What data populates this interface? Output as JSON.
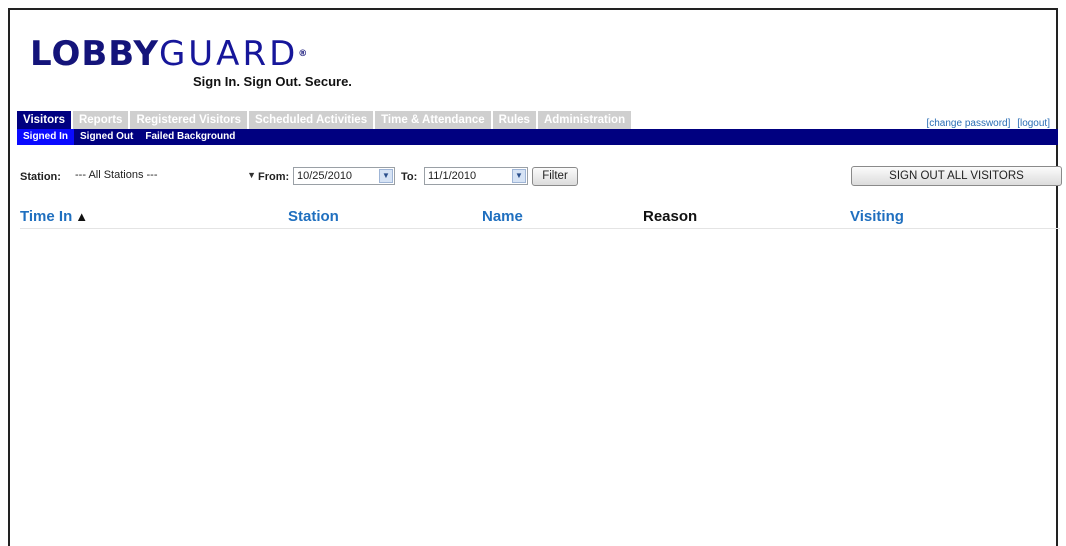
{
  "logo": {
    "part1": "LOBBY",
    "part2": "GUARD",
    "mark": "®"
  },
  "tagline": "Sign In. Sign Out. Secure.",
  "tabs": [
    {
      "label": "Visitors",
      "active": true
    },
    {
      "label": "Reports"
    },
    {
      "label": "Registered Visitors"
    },
    {
      "label": "Scheduled Activities"
    },
    {
      "label": "Time & Attendance"
    },
    {
      "label": "Rules"
    },
    {
      "label": "Administration"
    }
  ],
  "links": {
    "change_password": "[change password]",
    "logout": "[logout]"
  },
  "subtabs": [
    {
      "label": "Signed In",
      "active": true
    },
    {
      "label": "Signed Out"
    },
    {
      "label": "Failed Background"
    }
  ],
  "filter": {
    "station_label": "Station:",
    "station_value": "--- All Stations ---",
    "from_label": "From:",
    "from_value": "10/25/2010",
    "to_label": "To:",
    "to_value": "11/1/2010",
    "filter_button": "Filter",
    "sign_out_all_button": "SIGN OUT ALL VISITORS"
  },
  "table": {
    "columns": [
      "Time In",
      "Station",
      "Name",
      "Reason",
      "Visiting"
    ],
    "sort_icon": "triangle-up-icon",
    "rows": []
  },
  "colors": {
    "brand": "#000080",
    "link": "#1f6fbf",
    "tab_inactive": "#cfcfcf"
  }
}
